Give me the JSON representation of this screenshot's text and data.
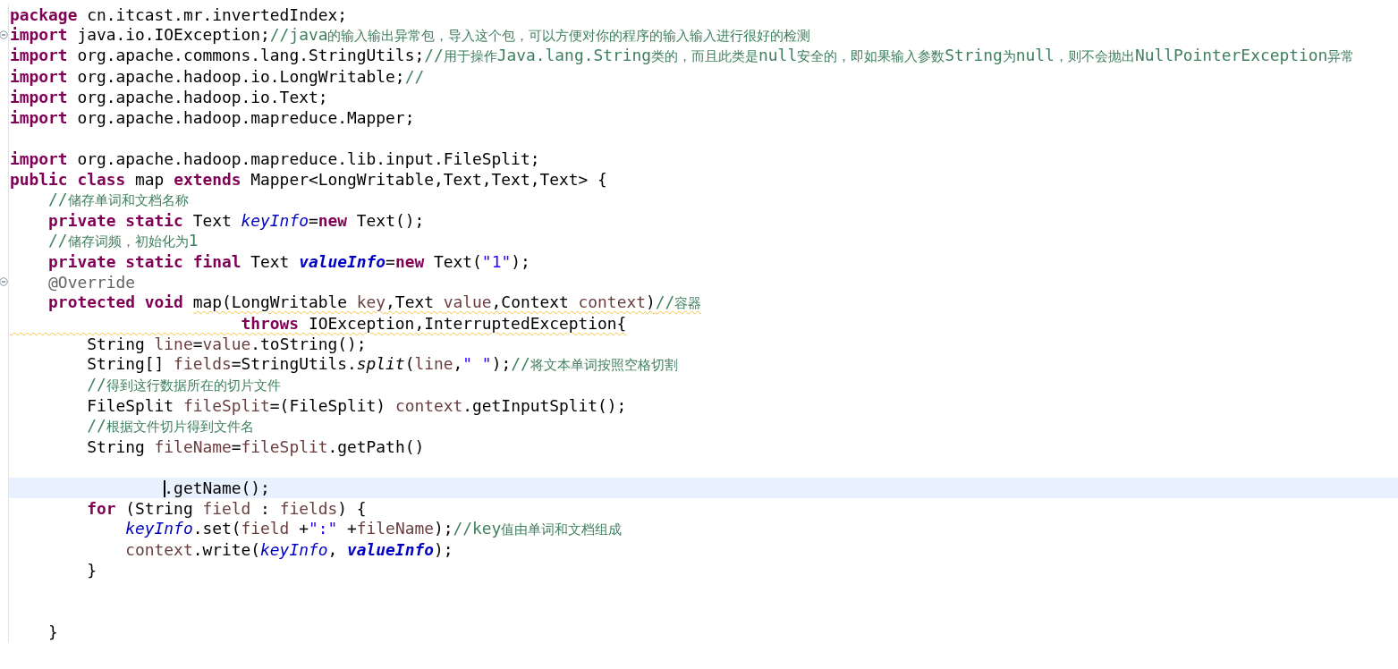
{
  "editor": {
    "lines": [
      {
        "foldable": false,
        "current": false,
        "tokens": [
          {
            "kind": "kw",
            "text": "package"
          },
          {
            "kind": "plain",
            "text": " cn.itcast.mr.invertedIndex;"
          }
        ]
      },
      {
        "foldable": true,
        "current": false,
        "tokens": [
          {
            "kind": "kw",
            "text": "import"
          },
          {
            "kind": "plain",
            "text": " java.io.IOException;"
          },
          {
            "kind": "comment",
            "text": "//java"
          },
          {
            "kind": "cjk",
            "text": "的输入输出异常包，导入这个包，可以方便对你的程序的输入输入进行很好的检测"
          }
        ]
      },
      {
        "foldable": false,
        "current": false,
        "tokens": [
          {
            "kind": "kw",
            "text": "import"
          },
          {
            "kind": "plain",
            "text": " org.apache.commons.lang.StringUtils;"
          },
          {
            "kind": "comment",
            "text": "//"
          },
          {
            "kind": "cjk",
            "text": "用于操作"
          },
          {
            "kind": "comment",
            "text": "Java.lang.String"
          },
          {
            "kind": "cjk",
            "text": "类的，而且此类是"
          },
          {
            "kind": "comment",
            "text": "null"
          },
          {
            "kind": "cjk",
            "text": "安全的，即如果输入参数"
          },
          {
            "kind": "comment",
            "text": "String"
          },
          {
            "kind": "cjk",
            "text": "为"
          },
          {
            "kind": "comment",
            "text": "null"
          },
          {
            "kind": "cjk",
            "text": "，则不会抛出"
          },
          {
            "kind": "comment",
            "text": "NullPointerException"
          },
          {
            "kind": "cjk",
            "text": "异常"
          }
        ]
      },
      {
        "foldable": false,
        "current": false,
        "tokens": [
          {
            "kind": "kw",
            "text": "import"
          },
          {
            "kind": "plain",
            "text": " org.apache.hadoop.io.LongWritable;"
          },
          {
            "kind": "comment",
            "text": "//"
          }
        ]
      },
      {
        "foldable": false,
        "current": false,
        "tokens": [
          {
            "kind": "kw",
            "text": "import"
          },
          {
            "kind": "plain",
            "text": " org.apache.hadoop.io.Text;"
          }
        ]
      },
      {
        "foldable": false,
        "current": false,
        "tokens": [
          {
            "kind": "kw",
            "text": "import"
          },
          {
            "kind": "plain",
            "text": " org.apache.hadoop.mapreduce.Mapper;"
          }
        ]
      },
      {
        "foldable": false,
        "current": false
      },
      {
        "foldable": false,
        "current": false,
        "tokens": [
          {
            "kind": "kw",
            "text": "import"
          },
          {
            "kind": "plain",
            "text": " org.apache.hadoop.mapreduce.lib.input.FileSplit;"
          }
        ]
      },
      {
        "foldable": false,
        "current": false,
        "tokens": [
          {
            "kind": "kw",
            "text": "public class"
          },
          {
            "kind": "plain",
            "text": " map "
          },
          {
            "kind": "kw",
            "text": "extends"
          },
          {
            "kind": "plain",
            "text": " Mapper<LongWritable,Text,Text,Text> {"
          }
        ]
      },
      {
        "foldable": false,
        "current": false,
        "tokens": [
          {
            "kind": "comment",
            "text": "    //"
          },
          {
            "kind": "cjk",
            "text": "储存单词和文档名称"
          }
        ]
      },
      {
        "foldable": false,
        "current": false,
        "tokens": [
          {
            "kind": "kw",
            "text": "    private static"
          },
          {
            "kind": "plain",
            "text": " Text "
          },
          {
            "kind": "static_field",
            "text": "keyInfo"
          },
          {
            "kind": "plain",
            "text": "="
          },
          {
            "kind": "kw",
            "text": "new"
          },
          {
            "kind": "plain",
            "text": " Text();"
          }
        ]
      },
      {
        "foldable": false,
        "current": false,
        "tokens": [
          {
            "kind": "comment",
            "text": "    //"
          },
          {
            "kind": "cjk",
            "text": "储存词频，初始化为"
          },
          {
            "kind": "comment",
            "text": "1"
          }
        ]
      },
      {
        "foldable": false,
        "current": false,
        "tokens": [
          {
            "kind": "kw",
            "text": "    private static final"
          },
          {
            "kind": "plain",
            "text": " Text "
          },
          {
            "kind": "const_field",
            "text": "valueInfo"
          },
          {
            "kind": "plain",
            "text": "="
          },
          {
            "kind": "kw",
            "text": "new"
          },
          {
            "kind": "plain",
            "text": " Text("
          },
          {
            "kind": "str",
            "text": "\"1\""
          },
          {
            "kind": "plain",
            "text": ");"
          }
        ]
      },
      {
        "foldable": true,
        "current": false,
        "tokens": [
          {
            "kind": "annot",
            "text": "    @Override"
          }
        ]
      },
      {
        "foldable": false,
        "current": false,
        "tokens": [
          {
            "kind": "kw",
            "text": "    protected void "
          },
          {
            "kind": "plain",
            "text": "map(LongWritable ",
            "warning": true
          },
          {
            "kind": "local",
            "text": "key",
            "warning": true
          },
          {
            "kind": "plain",
            "text": ",Text ",
            "warning": true
          },
          {
            "kind": "local",
            "text": "value",
            "warning": true
          },
          {
            "kind": "plain",
            "text": ",Context ",
            "warning": true
          },
          {
            "kind": "local",
            "text": "context",
            "warning": true
          },
          {
            "kind": "plain",
            "text": ")",
            "warning": true
          },
          {
            "kind": "comment",
            "text": "//",
            "warning": true
          },
          {
            "kind": "cjk",
            "text": "容器",
            "warning": true
          }
        ]
      },
      {
        "foldable": false,
        "current": false,
        "tokens": [
          {
            "kind": "kw",
            "text": "                        throws",
            "warning": true
          },
          {
            "kind": "plain",
            "text": " IOException,InterruptedException{",
            "warning": true
          }
        ]
      },
      {
        "foldable": false,
        "current": false,
        "tokens": [
          {
            "kind": "plain",
            "text": "        String "
          },
          {
            "kind": "local",
            "text": "line"
          },
          {
            "kind": "plain",
            "text": "="
          },
          {
            "kind": "local",
            "text": "value"
          },
          {
            "kind": "plain",
            "text": ".toString();"
          }
        ]
      },
      {
        "foldable": false,
        "current": false,
        "tokens": [
          {
            "kind": "plain",
            "text": "        String[] "
          },
          {
            "kind": "local",
            "text": "fields"
          },
          {
            "kind": "plain",
            "text": "=StringUtils."
          },
          {
            "kind": "static_method",
            "text": "split"
          },
          {
            "kind": "plain",
            "text": "("
          },
          {
            "kind": "local",
            "text": "line"
          },
          {
            "kind": "plain",
            "text": ","
          },
          {
            "kind": "str",
            "text": "\" \""
          },
          {
            "kind": "plain",
            "text": ");"
          },
          {
            "kind": "comment",
            "text": "//"
          },
          {
            "kind": "cjk",
            "text": "将文本单词按照空格切割"
          }
        ]
      },
      {
        "foldable": false,
        "current": false,
        "tokens": [
          {
            "kind": "comment",
            "text": "        //"
          },
          {
            "kind": "cjk",
            "text": "得到这行数据所在的切片文件"
          }
        ]
      },
      {
        "foldable": false,
        "current": false,
        "tokens": [
          {
            "kind": "plain",
            "text": "        FileSplit "
          },
          {
            "kind": "local",
            "text": "fileSplit"
          },
          {
            "kind": "plain",
            "text": "=(FileSplit) "
          },
          {
            "kind": "local",
            "text": "context"
          },
          {
            "kind": "plain",
            "text": ".getInputSplit();"
          }
        ]
      },
      {
        "foldable": false,
        "current": false,
        "tokens": [
          {
            "kind": "comment",
            "text": "        //"
          },
          {
            "kind": "cjk",
            "text": "根据文件切片得到文件名"
          }
        ]
      },
      {
        "foldable": false,
        "current": false,
        "tokens": [
          {
            "kind": "plain",
            "text": "        String "
          },
          {
            "kind": "local",
            "text": "fileName"
          },
          {
            "kind": "plain",
            "text": "="
          },
          {
            "kind": "local",
            "text": "fileSplit"
          },
          {
            "kind": "plain",
            "text": ".getPath()"
          }
        ]
      },
      {
        "foldable": false,
        "current": false
      },
      {
        "foldable": false,
        "current": true,
        "tokens": [
          {
            "kind": "plain",
            "text": "                .getName();",
            "caret": true
          }
        ]
      },
      {
        "foldable": false,
        "current": false,
        "tokens": [
          {
            "kind": "kw",
            "text": "        for"
          },
          {
            "kind": "plain",
            "text": " (String "
          },
          {
            "kind": "local",
            "text": "field"
          },
          {
            "kind": "plain",
            "text": " : "
          },
          {
            "kind": "local",
            "text": "fields"
          },
          {
            "kind": "plain",
            "text": ") {"
          }
        ]
      },
      {
        "foldable": false,
        "current": false,
        "tokens": [
          {
            "kind": "static_field",
            "text": "            keyInfo"
          },
          {
            "kind": "plain",
            "text": ".set("
          },
          {
            "kind": "local",
            "text": "field"
          },
          {
            "kind": "plain",
            "text": " +"
          },
          {
            "kind": "str",
            "text": "\":\""
          },
          {
            "kind": "plain",
            "text": " +"
          },
          {
            "kind": "local",
            "text": "fileName"
          },
          {
            "kind": "plain",
            "text": ");"
          },
          {
            "kind": "comment",
            "text": "//key"
          },
          {
            "kind": "cjk",
            "text": "值由单词和文档组成"
          }
        ]
      },
      {
        "foldable": false,
        "current": false,
        "tokens": [
          {
            "kind": "local",
            "text": "            context"
          },
          {
            "kind": "plain",
            "text": ".write("
          },
          {
            "kind": "static_field",
            "text": "keyInfo"
          },
          {
            "kind": "plain",
            "text": ", "
          },
          {
            "kind": "const_field",
            "text": "valueInfo"
          },
          {
            "kind": "plain",
            "text": ");"
          }
        ]
      },
      {
        "foldable": false,
        "current": false,
        "tokens": [
          {
            "kind": "plain",
            "text": "        }"
          }
        ]
      },
      {
        "foldable": false,
        "current": false
      },
      {
        "foldable": false,
        "current": false
      },
      {
        "foldable": false,
        "current": false,
        "tokens": [
          {
            "kind": "plain",
            "text": "    }"
          }
        ]
      }
    ]
  }
}
